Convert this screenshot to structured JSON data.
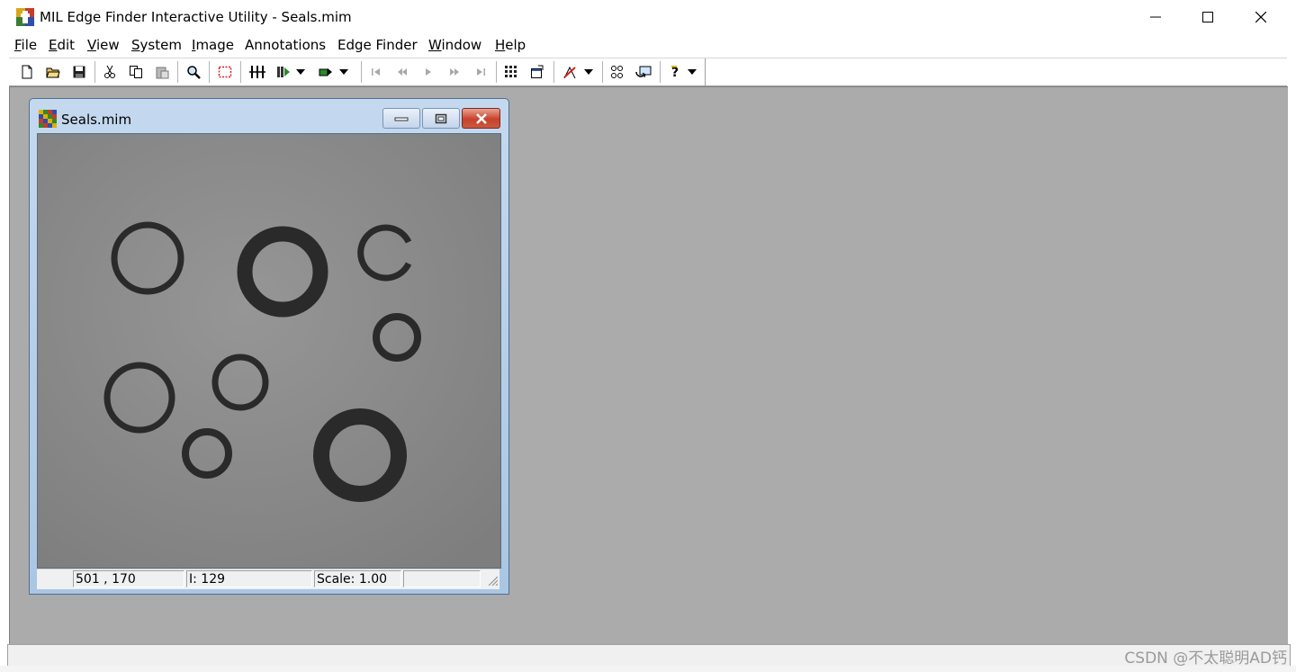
{
  "app": {
    "title": "MIL Edge Finder Interactive Utility - Seals.mim"
  },
  "menu": {
    "items": [
      {
        "key": "F",
        "rest": "ile"
      },
      {
        "key": "E",
        "rest": "dit"
      },
      {
        "key": "V",
        "rest": "iew"
      },
      {
        "key": "S",
        "rest": "ystem"
      },
      {
        "key": "I",
        "rest": "mage"
      },
      {
        "key": "",
        "rest": "Annotations"
      },
      {
        "key": "",
        "rest": "Edge Finder"
      },
      {
        "key": "W",
        "rest": "indow"
      },
      {
        "key": "H",
        "rest": "elp"
      }
    ]
  },
  "toolbar": {
    "icons": [
      "new-icon",
      "open-icon",
      "save-icon",
      "cut-icon",
      "copy-icon",
      "paste-icon",
      "zoom-icon",
      "roi-rect-icon",
      "threshold-icon",
      "run-dropdown-icon",
      "step-dropdown-icon",
      "first-frame-icon",
      "prev-frame-icon",
      "play-icon",
      "next-frame-icon",
      "last-frame-icon",
      "grid-icon",
      "properties-icon",
      "annotate-dropdown-icon",
      "edge-detect-icon",
      "refresh-icon",
      "help-dropdown-icon"
    ]
  },
  "child": {
    "title": "Seals.mim",
    "status": {
      "coords": "501 , 170",
      "intensity": "I: 129",
      "scale": "Scale: 1.00",
      "empty": ""
    }
  },
  "watermark": "CSDN @不太聪明AD钙"
}
